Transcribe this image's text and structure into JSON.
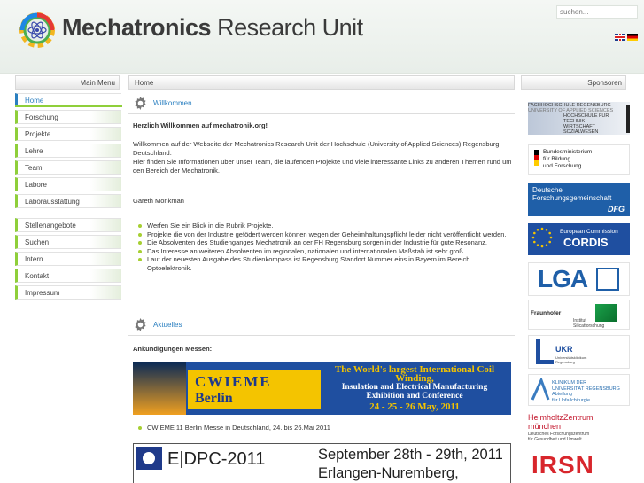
{
  "header": {
    "title_bold": "Mechatronics",
    "title_rest": " Research Unit",
    "search_placeholder": "suchen...",
    "languages": [
      "English",
      "Deutsch"
    ]
  },
  "bars": {
    "menu": "Main Menu",
    "breadcrumb": "Home",
    "sponsors": "Sponsoren"
  },
  "nav_main": [
    {
      "label": "Home",
      "active": true
    },
    {
      "label": "Forschung"
    },
    {
      "label": "Projekte"
    },
    {
      "label": "Lehre"
    },
    {
      "label": "Team"
    },
    {
      "label": "Labore"
    },
    {
      "label": "Laborausstattung"
    }
  ],
  "nav_secondary": [
    {
      "label": "Stellenangebote"
    },
    {
      "label": "Suchen"
    },
    {
      "label": "Intern"
    },
    {
      "label": "Kontakt"
    },
    {
      "label": "Impressum"
    }
  ],
  "welcome": {
    "title": "Willkommen",
    "heading": "Herzlich Willkommen auf mechatronik.org!",
    "p1": "Willkommen auf der Webseite der Mechatronics Research Unit der Hochschule (University of Applied Sciences) Regensburg, Deutschland.",
    "p2": "Hier finden Sie Informationen über unser Team, die laufenden Projekte und viele interessante Links zu anderen Themen rund um den Bereich der Mechatronik.",
    "signature": "Gareth Monkman",
    "bullets": [
      "Werfen Sie ein Blick in die Rubrik Projekte.",
      "Projekte die von der Industrie gefödert werden können wegen der Geheimhaltungspflicht leider nicht veröffentlicht werden.",
      "Die Absolventen des Studienganges Mechatronik an der FH Regensburg sorgen in der Industrie für gute Resonanz.",
      "Das Interesse an weiteren Absolventen im regionalen, nationalen und internationalen Maßstab ist sehr groß.",
      "Laut der neuesten Ausgabe des Studienkompass ist Regensburg Standort Nummer eins in Bayern im Bereich Optoelektronik."
    ]
  },
  "news": {
    "title": "Aktuelles",
    "heading": "Ankündigungen Messen:",
    "banner": {
      "name_1": "CWIEME",
      "name_2": "Berlin",
      "headline_1": "The World's largest International Coil Winding,",
      "headline_2": "Insulation and Electrical Manufacturing",
      "headline_3": "Exhibition and Conference",
      "dates": "24 - 25 - 26 May, 2011"
    },
    "item": "CWIEME 11 Berlin Messe in Deutschland, 24. bis 26.Mai 2011",
    "edpc": {
      "logo": "E|DPC-2011",
      "line1": "September 28th - 29th, 2011",
      "line2": "Erlangen-Nuremberg,"
    }
  },
  "sponsors": [
    {
      "name": "Fachhochschule Regensburg",
      "text": [
        "FACHHOCHSCHULE REGENSBURG",
        "UNIVERSITY OF APPLIED SCIENCES",
        "HOCHSCHULE FÜR",
        "TECHNIK",
        "WIRTSCHAFT",
        "SOZIALWESEN"
      ]
    },
    {
      "name": "Bundesministerium für Bildung und Forschung",
      "text": [
        "Bundesministerium",
        "für Bildung",
        "und Forschung"
      ]
    },
    {
      "name": "Deutsche Forschungsgemeinschaft",
      "text": [
        "Deutsche",
        "Forschungsgemeinschaft",
        "DFG"
      ]
    },
    {
      "name": "European Commission CORDIS",
      "text": [
        "European Commission",
        "CORDIS"
      ]
    },
    {
      "name": "LGA",
      "text": [
        "LGA"
      ]
    },
    {
      "name": "Fraunhofer Institut Silicatforschung",
      "text": [
        "Fraunhofer",
        "Institut",
        "Silicatforschung"
      ]
    },
    {
      "name": "Universitätsklinikum Regensburg",
      "text": [
        "UKR",
        "Universitätsklinikum",
        "Regensburg"
      ]
    },
    {
      "name": "Klinikum der Universität Regensburg",
      "text": [
        "KLINIKUM DER",
        "UNIVERSITÄT REGENSBURG",
        "Abteilung",
        "für Unfallchirurgie"
      ]
    },
    {
      "name": "Helmholtz Zentrum München",
      "text": [
        "HelmholtzZentrum",
        "münchen",
        "Deutsches Forschungszentrum",
        "für Gesundheit und Umwelt"
      ]
    },
    {
      "name": "IRSN",
      "text": [
        "IRSN"
      ]
    }
  ],
  "colors": {
    "accent_blue": "#2a7fc0",
    "accent_green": "#8fcf3a",
    "dfg_blue": "#1f5fa8",
    "eu_blue": "#1f4fa0",
    "helmholtz_red": "#c3162c"
  }
}
